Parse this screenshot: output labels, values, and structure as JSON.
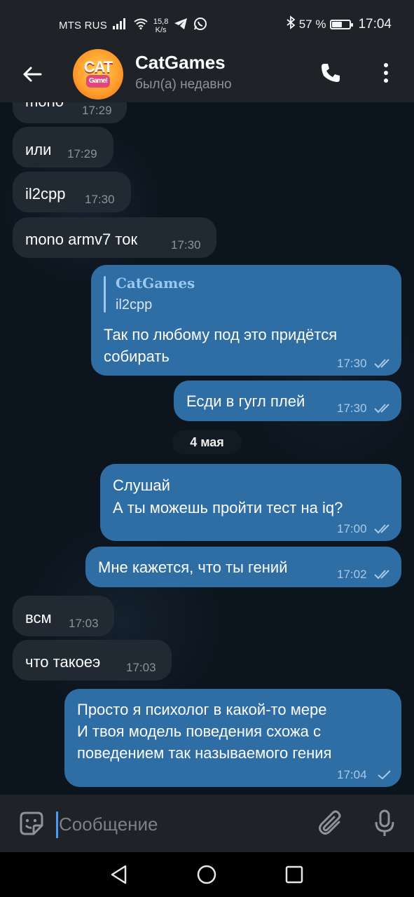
{
  "status_bar": {
    "carrier": "MTS RUS",
    "speed_value": "15,8",
    "speed_unit": "K/s",
    "battery_percent": "57 %",
    "battery_level": 0.57,
    "time": "17:04",
    "icons": [
      "signal-icon",
      "wifi-icon",
      "telegram-icon",
      "whatsapp-icon",
      "bluetooth-icon",
      "battery-icon"
    ]
  },
  "header": {
    "title": "CatGames",
    "status": "был(а) недавно",
    "avatar_text": "CAT",
    "avatar_subtext": "Game!"
  },
  "messages": [
    {
      "dir": "in",
      "text": "mono",
      "time": "17:29"
    },
    {
      "dir": "in",
      "text": "или",
      "time": "17:29"
    },
    {
      "dir": "in",
      "text": "il2cpp",
      "time": "17:30"
    },
    {
      "dir": "in",
      "text": "mono armv7 ток",
      "time": "17:30"
    },
    {
      "dir": "out",
      "reply_name": "CatGames",
      "reply_text": "il2cpp",
      "lines": [
        "Так по любому под это придётся",
        "собирать"
      ],
      "time": "17:30",
      "read": true
    },
    {
      "dir": "out",
      "text": "Есди в гугл плей",
      "time": "17:30",
      "read": true
    },
    {
      "dir": "out",
      "lines": [
        "Слушай",
        "А ты можешь пройти тест на iq?"
      ],
      "time": "17:00",
      "read": true
    },
    {
      "dir": "out",
      "text": "Мне кажется, что ты гений",
      "time": "17:02",
      "read": true
    },
    {
      "dir": "in",
      "text": "всм",
      "time": "17:03"
    },
    {
      "dir": "in",
      "text": "что такоеэ",
      "time": "17:03"
    },
    {
      "dir": "out",
      "lines": [
        "Просто я психолог в какой-то мере",
        "И твоя модель поведения схожа с",
        "поведением так называемого гения"
      ],
      "time": "17:04",
      "read": false
    }
  ],
  "date_separator": "4 мая",
  "input": {
    "placeholder": "Сообщение",
    "value": ""
  },
  "colors": {
    "incoming_bubble": "#212a33",
    "outgoing_bubble": "#2f6ea5",
    "accent": "#4a9cf0",
    "header_bg": "#1f2226"
  }
}
